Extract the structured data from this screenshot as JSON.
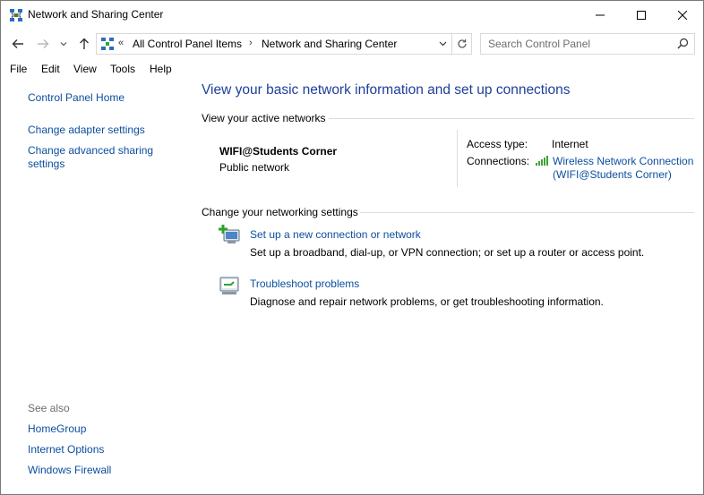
{
  "window": {
    "title": "Network and Sharing Center"
  },
  "address_bar": {
    "overflow_chevron": "«",
    "breadcrumbs": [
      "All Control Panel Items",
      "Network and Sharing Center"
    ],
    "separator": "›"
  },
  "search": {
    "placeholder": "Search Control Panel"
  },
  "menu": {
    "items": [
      "File",
      "Edit",
      "View",
      "Tools",
      "Help"
    ]
  },
  "left_pane": {
    "home_link": "Control Panel Home",
    "links": [
      "Change adapter settings",
      "Change advanced sharing settings"
    ],
    "see_also_label": "See also",
    "see_also_links": [
      "HomeGroup",
      "Internet Options",
      "Windows Firewall"
    ]
  },
  "main": {
    "title": "View your basic network information and set up connections",
    "active_networks_heading": "View your active networks",
    "network": {
      "name": "WIFI@Students Corner",
      "type": "Public network",
      "access_type_label": "Access type:",
      "access_type_value": "Internet",
      "connections_label": "Connections:",
      "connection_line1": "Wireless Network Connection",
      "connection_line2": "(WIFI@Students Corner)"
    },
    "settings_heading": "Change your networking settings",
    "tasks": [
      {
        "link": "Set up a new connection or network",
        "description": "Set up a broadband, dial-up, or VPN connection; or set up a router or access point.",
        "icon": "new-connection-icon"
      },
      {
        "link": "Troubleshoot problems",
        "description": "Diagnose and repair network problems, or get troubleshooting information.",
        "icon": "troubleshoot-icon"
      }
    ]
  },
  "colors": {
    "link": "#0b4e9e",
    "title": "#1e3f9a",
    "signal": "#3aa535"
  }
}
